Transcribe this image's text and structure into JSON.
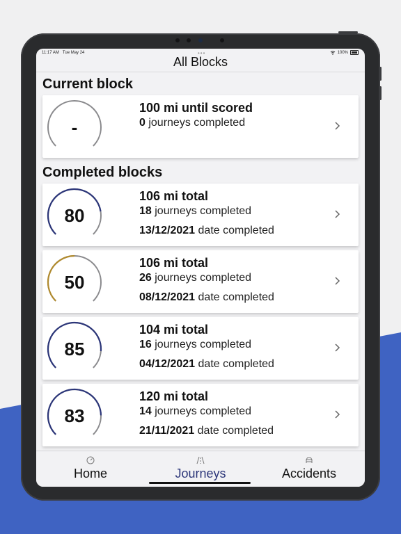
{
  "status": {
    "time": "11:17 AM",
    "date": "Tue May 24",
    "battery": "100%"
  },
  "nav": {
    "title": "All Blocks"
  },
  "sections": {
    "current": "Current block",
    "completed": "Completed blocks"
  },
  "current_block": {
    "score": "-",
    "distance": "100 mi until scored",
    "journeys": "0",
    "journeys_suffix": " journeys completed",
    "progress": 0
  },
  "completed_blocks": [
    {
      "score": "80",
      "total": "106 mi total",
      "journeys": "18",
      "journeys_suffix": " journeys completed",
      "date": "13/12/2021",
      "date_suffix": " date completed",
      "color": "#2c3679"
    },
    {
      "score": "50",
      "total": "106 mi total",
      "journeys": "26",
      "journeys_suffix": " journeys completed",
      "date": "08/12/2021",
      "date_suffix": " date completed",
      "color": "#b08a2e"
    },
    {
      "score": "85",
      "total": "104 mi total",
      "journeys": "16",
      "journeys_suffix": " journeys completed",
      "date": "04/12/2021",
      "date_suffix": " date completed",
      "color": "#2c3679"
    },
    {
      "score": "83",
      "total": "120 mi total",
      "journeys": "14",
      "journeys_suffix": " journeys completed",
      "date": "21/11/2021",
      "date_suffix": " date completed",
      "color": "#2c3679"
    }
  ],
  "tabs": [
    {
      "label": "Home",
      "icon": "speedometer-icon"
    },
    {
      "label": "Journeys",
      "icon": "road-icon",
      "active": true
    },
    {
      "label": "Accidents",
      "icon": "car-icon"
    }
  ],
  "colors": {
    "accent": "#2c3679",
    "gauge_track": "#8a8a8d",
    "background_blue": "#3f63c2"
  }
}
